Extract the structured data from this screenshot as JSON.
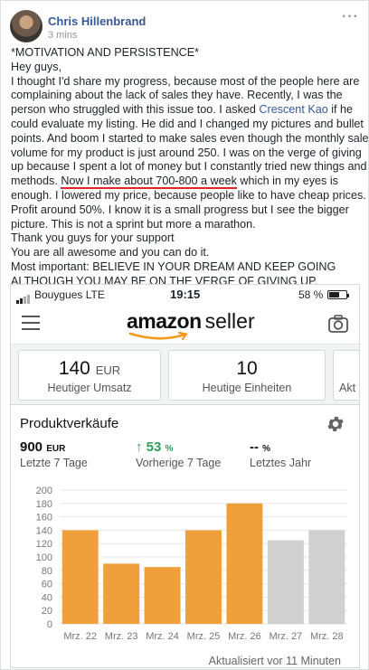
{
  "post": {
    "author": "Chris Hillenbrand",
    "timestamp": "3 mins",
    "lines": [
      "*MOTIVATION AND PERSISTENCE*",
      "Hey guys,",
      "I thought I'd share my progress, because most of the people here are",
      "complaining about the lack of sales they have. Recently, I was the",
      "person who struggled with this issue too. I asked "
    ],
    "mention": "Crescent Kao",
    "after_mention": " if he",
    "lines2": [
      "could evaluate my listing. He did and I changed my pictures and bullet",
      "points. And boom I started to make sales even though the monthly sales",
      "volume for my product is just around 250. I was on the verge of giving",
      "up because I spent a lot of money but I constantly tried new things and"
    ],
    "line_highlight_prefix": "methods. ",
    "highlight": "Now I make about 700-800 a week",
    "line_highlight_suffix": " which in my eyes is",
    "lines3": [
      "enough. I lowered my price, because people like to have cheap prices.",
      "Profit around 50%. I know it is a small progress but I see the bigger",
      "picture. This is not a sprint but more a marathon.",
      "Thank you guys for your support",
      "You are all awesome and you can do it.",
      "Most important: BELIEVE IN YOUR DREAM AND KEEP GOING",
      "ALTHOUGH YOU MAY BE ON THE VERGE OF GIVING UP."
    ]
  },
  "phone": {
    "carrier": "Bouygues  LTE",
    "time": "19:15",
    "battery": "58 %",
    "logo_amazon": "amazon",
    "logo_seller": "seller",
    "metrics": [
      {
        "value": "140",
        "unit": "EUR",
        "label": "Heutiger Umsatz"
      },
      {
        "value": "10",
        "unit": "",
        "label": "Heutige Einheiten"
      },
      {
        "value": "",
        "unit": "",
        "label": "Akt"
      }
    ],
    "card_title": "Produktverkäufe",
    "stats": [
      {
        "value": "900",
        "unit": "EUR",
        "label": "Letzte 7 Tage",
        "arrow": ""
      },
      {
        "value": "53",
        "unit": "%",
        "label": "Vorherige 7 Tage",
        "arrow": "↑"
      },
      {
        "value": "--",
        "unit": "%",
        "label": "Letztes Jahr",
        "arrow": ""
      }
    ],
    "updated": "Aktualisiert vor 11 Minuten"
  },
  "colors": {
    "bar_current": "#f0a03b",
    "bar_previous": "#d0d0d0",
    "link": "#365899",
    "underline": "#e0262a",
    "green": "#2e9e58"
  },
  "chart_data": {
    "type": "bar",
    "categories": [
      "Mrz. 22",
      "Mrz. 23",
      "Mrz. 24",
      "Mrz. 25",
      "Mrz. 26",
      "Mrz. 27",
      "Mrz. 28"
    ],
    "values": [
      140,
      90,
      85,
      140,
      180,
      125,
      140
    ],
    "highlighted": [
      true,
      true,
      true,
      true,
      true,
      false,
      false
    ],
    "yticks": [
      0,
      20,
      40,
      60,
      80,
      100,
      120,
      140,
      160,
      180,
      200
    ],
    "ylim": [
      0,
      200
    ],
    "grid": true
  }
}
